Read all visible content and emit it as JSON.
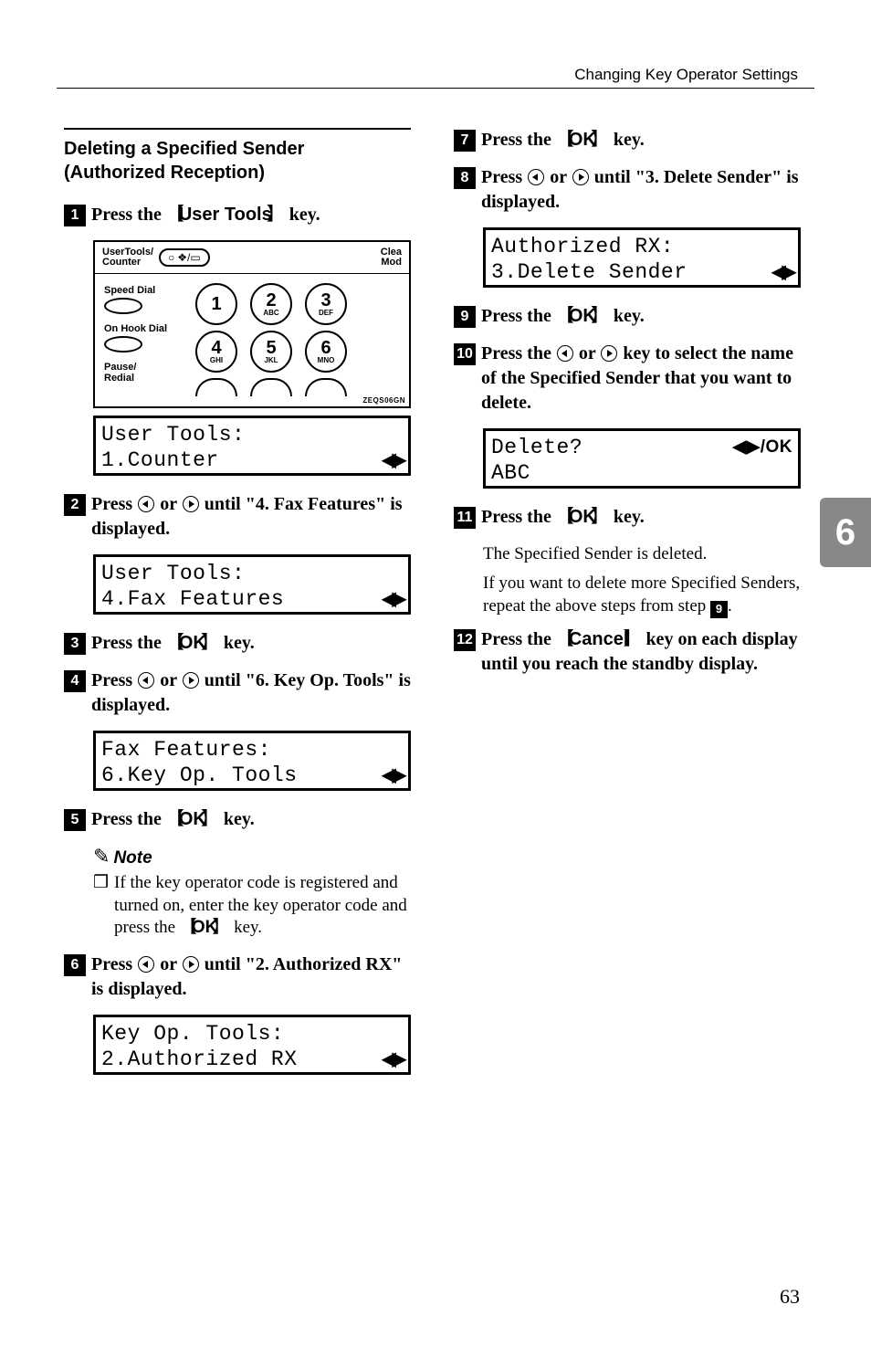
{
  "header": {
    "section": "Changing Key Operator Settings"
  },
  "sideTab": "6",
  "pageNumber": "63",
  "left": {
    "subsectionTitle": "Deleting a Specified Sender (Authorized Reception)",
    "step1": {
      "num": "1",
      "prefix": "Press the ",
      "key": "User Tools",
      "suffix": " key."
    },
    "keypad": {
      "topLeftLabel1": "UserTools/",
      "topLeftLabel2": "Counter",
      "topRight1": "Clea",
      "topRight2": "Mod",
      "sideLabels": {
        "speed": "Speed Dial",
        "onhook": "On Hook Dial",
        "pause": "Pause/",
        "redial": "Redial"
      },
      "keys": [
        {
          "big": "1",
          "sm": ""
        },
        {
          "big": "2",
          "sm": "ABC"
        },
        {
          "big": "3",
          "sm": "DEF"
        },
        {
          "big": "4",
          "sm": "GHI"
        },
        {
          "big": "5",
          "sm": "JKL"
        },
        {
          "big": "6",
          "sm": "MNO"
        }
      ],
      "tag": "ZEQS06GN"
    },
    "lcd1": {
      "line1": "User Tools:",
      "line2": "1.Counter"
    },
    "step2": {
      "num": "2",
      "prefix": "Press ",
      "mid": " or ",
      "suffix": " until \"4. Fax Features\" is displayed."
    },
    "lcd2": {
      "line1": "User Tools:",
      "line2": "4.Fax Features"
    },
    "step3": {
      "num": "3",
      "prefix": "Press the ",
      "key": "OK",
      "suffix": " key."
    },
    "step4": {
      "num": "4",
      "prefix": "Press ",
      "mid": " or ",
      "suffix": " until \"6. Key Op. Tools\" is displayed."
    },
    "lcd3": {
      "line1": "Fax Features:",
      "line2": "6.Key Op. Tools"
    },
    "step5": {
      "num": "5",
      "prefix": "Press the ",
      "key": "OK",
      "suffix": " key."
    },
    "note": {
      "head": "Note",
      "bullet": "❒",
      "body": "If the key operator code is registered and turned on, enter the key operator code and press the ",
      "key": "OK",
      "tail": " key."
    },
    "step6": {
      "num": "6",
      "prefix": "Press ",
      "mid": " or ",
      "suffix": " until \"2. Authorized RX\" is displayed."
    },
    "lcd4": {
      "line1": "Key Op. Tools:",
      "line2": "2.Authorized RX"
    }
  },
  "right": {
    "step7": {
      "num": "7",
      "prefix": "Press the ",
      "key": "OK",
      "suffix": " key."
    },
    "step8": {
      "num": "8",
      "prefix": "Press ",
      "mid": " or ",
      "suffix": " until \"3. Delete Sender\" is displayed."
    },
    "lcd5": {
      "line1": "Authorized RX:",
      "line2": "3.Delete Sender"
    },
    "step9": {
      "num": "9",
      "prefix": "Press the ",
      "key": "OK",
      "suffix": " key."
    },
    "step10": {
      "num": "10",
      "prefix": "Press the ",
      "mid": " or ",
      "suffix": " key to select the name of the Specified Sender that you want to delete."
    },
    "lcd6": {
      "line1L": "Delete?",
      "line1R": "◀▶/OK",
      "line2": "ABC"
    },
    "step11": {
      "num": "11",
      "prefix": "Press the ",
      "key": "OK",
      "suffix": " key."
    },
    "para1": "The Specified Sender is deleted.",
    "para2a": "If you want to delete more Specified Senders, repeat the above steps from step ",
    "para2step": "9",
    "para2b": ".",
    "step12": {
      "num": "12",
      "prefix": "Press the ",
      "key": "Cancel",
      "suffix": " key on each display until you reach the standby display."
    }
  }
}
